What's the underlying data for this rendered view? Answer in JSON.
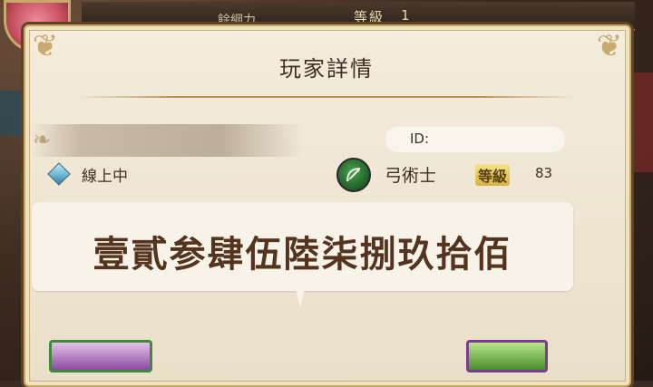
{
  "background": {
    "name_stub": "餘綱力",
    "level_label": "等級",
    "level_value": "1"
  },
  "dialog": {
    "title": "玩家詳情",
    "id_label": "ID:",
    "status": "線上中",
    "class_name": "弓術士",
    "level_label": "等級",
    "level_value": "83",
    "message": "壹貳参肆伍陸柒捌玖拾佰"
  },
  "colors": {
    "panel": "#f4ecdc",
    "gold_trim": "#c9a75e",
    "text_dark": "#3f2e22",
    "message_text": "#55341f",
    "online_icon": "#6db5d3",
    "class_icon": "#22632a"
  },
  "icons": {
    "status": "diamond-online-icon",
    "class": "bow-archer-icon"
  }
}
